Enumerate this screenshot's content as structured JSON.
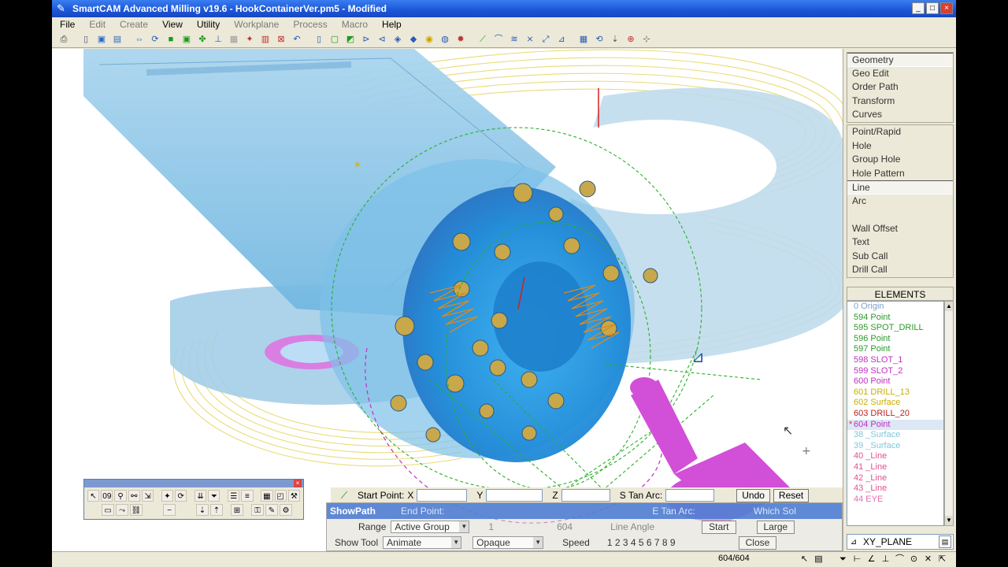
{
  "window": {
    "title": "SmartCAM Advanced Milling v19.6 - HookContainerVer.pm5 - Modified",
    "buttons": [
      "_",
      "□",
      "×"
    ]
  },
  "menu": [
    "File",
    "Edit",
    "Create",
    "View",
    "Utility",
    "Workplane",
    "Process",
    "Macro",
    "Help"
  ],
  "right_menu": {
    "group1": [
      "Geometry",
      "Geo Edit",
      "Order Path",
      "Transform",
      "Curves"
    ],
    "group2": [
      "Point/Rapid",
      "Hole",
      "Group Hole",
      "Hole Pattern",
      "Line",
      "Arc",
      "",
      "Wall Offset",
      "Text",
      "Sub Call",
      "Drill Call"
    ],
    "selected": "Line"
  },
  "elements": {
    "header": "ELEMENTS",
    "rows": [
      {
        "text": "0 Origin",
        "color": "#7fa0c8"
      },
      {
        "text": "594 Point",
        "color": "#2a9a2a"
      },
      {
        "text": "595 SPOT_DRILL",
        "color": "#2a9a2a"
      },
      {
        "text": "596 Point",
        "color": "#2a9a2a"
      },
      {
        "text": "597 Point",
        "color": "#2a9a2a"
      },
      {
        "text": "598 SLOT_1",
        "color": "#c030c0"
      },
      {
        "text": "599 SLOT_2",
        "color": "#c030c0"
      },
      {
        "text": "600 Point",
        "color": "#c030c0"
      },
      {
        "text": "601 DRILL_13",
        "color": "#c8b000"
      },
      {
        "text": "602 Surface",
        "color": "#c8b000"
      },
      {
        "text": "603 DRILL_20",
        "color": "#c02020"
      },
      {
        "text": "604 Point",
        "color": "#c030c0"
      },
      {
        "text": "38 _Surface",
        "color": "#7fc8d8"
      },
      {
        "text": "39 _Surface",
        "color": "#7fc8d8"
      },
      {
        "text": "40 _Line",
        "color": "#e05090"
      },
      {
        "text": "41 _Line",
        "color": "#e05090"
      },
      {
        "text": "42 _Line",
        "color": "#e05090"
      },
      {
        "text": "43 _Line",
        "color": "#e05090"
      },
      {
        "text": "44 EYE",
        "color": "#e070b0"
      }
    ],
    "selected_index": 11
  },
  "plane": "XY_PLANE",
  "status": {
    "count": "604/604"
  },
  "input_bar": {
    "start_point_label": "Start Point:",
    "x": "X",
    "y": "Y",
    "z": "Z",
    "s_tan_arc": "S Tan Arc:",
    "undo": "Undo",
    "reset": "Reset"
  },
  "showpath": {
    "title": "ShowPath",
    "ghost_end_point": "End Point:",
    "ghost_e_tan_arc": "E Tan Arc:",
    "ghost_which_sol": "Which Sol",
    "range_label": "Range",
    "range_value": "Active Group",
    "start_label": "Start",
    "large_label": "Large",
    "show_tool_label": "Show Tool",
    "show_tool_value": "Animate",
    "opaque_value": "Opaque",
    "speed_label": "Speed",
    "speed_values": "1 2 3 4 5 6 7 8 9",
    "close_label": "Close",
    "line_angle": "Line Angle",
    "start_field": "1",
    "end_field": "604"
  }
}
